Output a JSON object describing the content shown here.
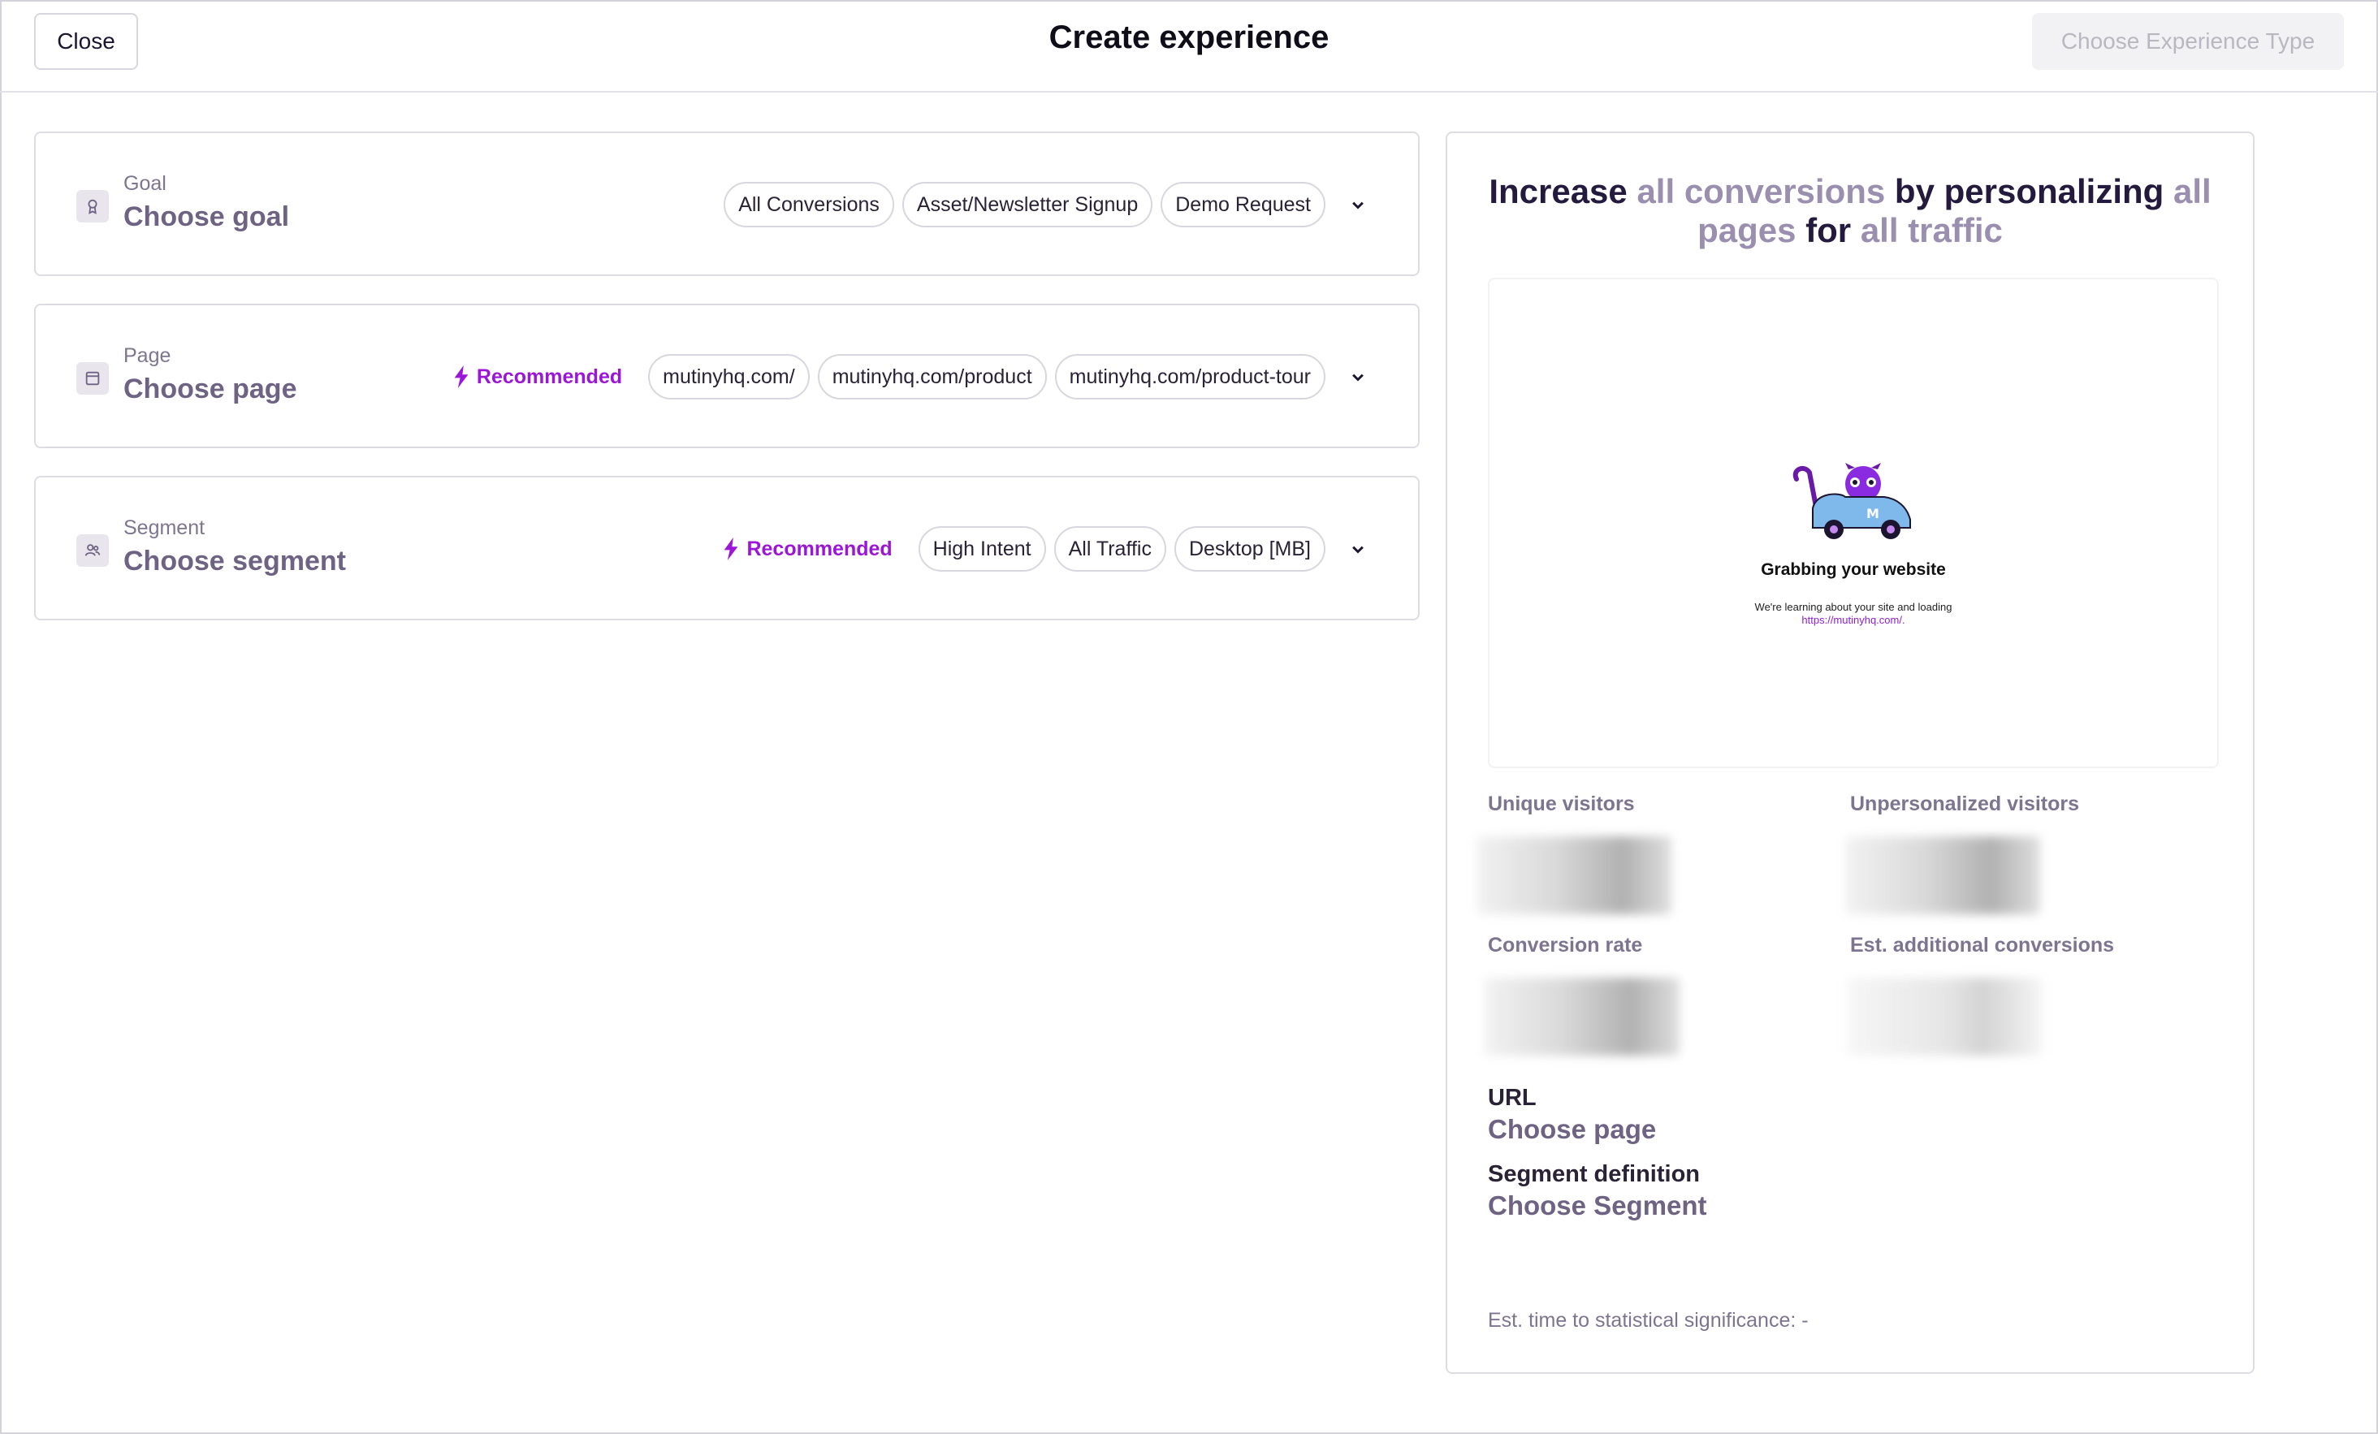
{
  "header": {
    "close_label": "Close",
    "title": "Create experience",
    "choose_type_label": "Choose Experience Type"
  },
  "goal": {
    "label": "Goal",
    "value": "Choose goal",
    "chips": [
      "All Conversions",
      "Asset/Newsletter Signup",
      "Demo Request"
    ]
  },
  "page": {
    "label": "Page",
    "value": "Choose page",
    "recommended": "Recommended",
    "chips": [
      "mutinyhq.com/",
      "mutinyhq.com/product",
      "mutinyhq.com/product-tour"
    ]
  },
  "segment": {
    "label": "Segment",
    "value": "Choose segment",
    "recommended": "Recommended",
    "chips": [
      "High Intent",
      "All Traffic",
      "Desktop [MB]"
    ]
  },
  "summary": {
    "w1": "Increase",
    "w2": "all conversions",
    "w3": "by personalizing",
    "w4": "all pages",
    "w5": "for",
    "w6": "all traffic"
  },
  "preview": {
    "title": "Grabbing your website",
    "subtitle": "We're learning about your site and loading",
    "link": "https://mutinyhq.com/."
  },
  "stats": {
    "unique_visitors": "Unique visitors",
    "unpersonalized_visitors": "Unpersonalized visitors",
    "conversion_rate": "Conversion rate",
    "est_additional": "Est. additional conversions"
  },
  "info": {
    "url_label": "URL",
    "url_value": "Choose page",
    "segment_label": "Segment definition",
    "segment_value": "Choose Segment",
    "significance": "Est. time to statistical significance: -"
  },
  "colors": {
    "accent_purple": "#9b16d6",
    "muted_text": "#6f6384",
    "headline_dark": "#231a3d"
  }
}
